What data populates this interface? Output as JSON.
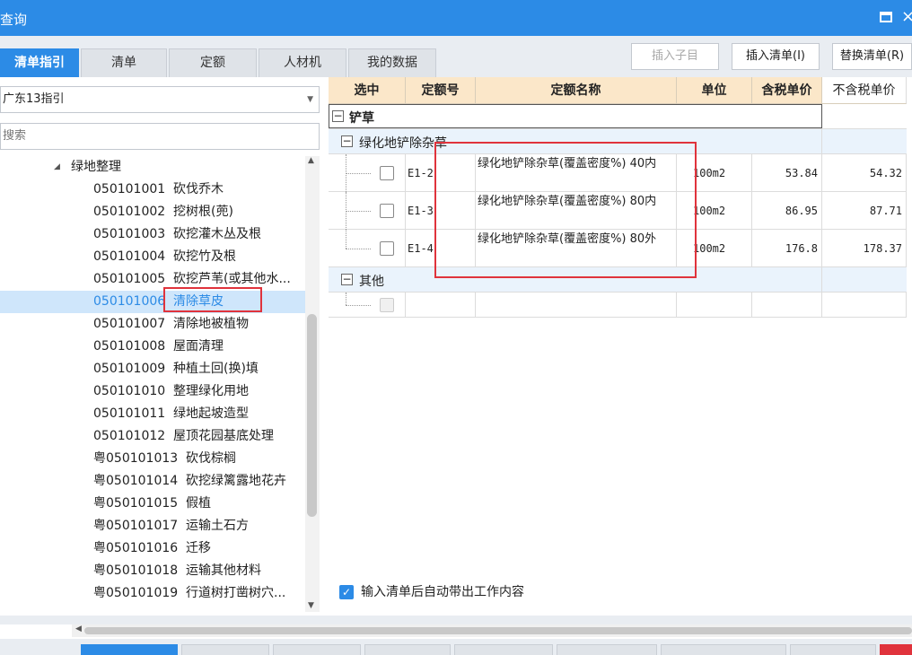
{
  "window": {
    "title": "查询"
  },
  "tabs": [
    {
      "label": "清单指引",
      "active": true
    },
    {
      "label": "清单",
      "active": false
    },
    {
      "label": "定额",
      "active": false
    },
    {
      "label": "人材机",
      "active": false
    },
    {
      "label": "我的数据",
      "active": false
    }
  ],
  "toolbar": {
    "insert_child": "插入子目",
    "insert_list": "插入清单(I)",
    "replace_list": "替换清单(R)"
  },
  "left": {
    "combo_value": "广东13指引",
    "search_placeholder": "搜索",
    "parent": "绿地整理",
    "items": [
      {
        "code": "050101001",
        "name": "砍伐乔木"
      },
      {
        "code": "050101002",
        "name": "挖树根(蔸)"
      },
      {
        "code": "050101003",
        "name": "砍挖灌木丛及根"
      },
      {
        "code": "050101004",
        "name": "砍挖竹及根"
      },
      {
        "code": "050101005",
        "name": "砍挖芦苇(或其他水..."
      },
      {
        "code": "050101006",
        "name": "清除草皮",
        "selected": true
      },
      {
        "code": "050101007",
        "name": "清除地被植物"
      },
      {
        "code": "050101008",
        "name": "屋面清理"
      },
      {
        "code": "050101009",
        "name": "种植土回(换)填"
      },
      {
        "code": "050101010",
        "name": "整理绿化用地"
      },
      {
        "code": "050101011",
        "name": "绿地起坡造型"
      },
      {
        "code": "050101012",
        "name": "屋顶花园基底处理"
      },
      {
        "code": "粤050101013",
        "name": "砍伐棕榈"
      },
      {
        "code": "粤050101014",
        "name": "砍挖绿篱露地花卉"
      },
      {
        "code": "粤050101015",
        "name": "假植"
      },
      {
        "code": "粤050101017",
        "name": "运输土石方"
      },
      {
        "code": "粤050101016",
        "name": "迁移"
      },
      {
        "code": "粤050101018",
        "name": "运输其他材料"
      },
      {
        "code": "粤050101019",
        "name": "行道树打凿树穴..."
      }
    ]
  },
  "table": {
    "headers": {
      "select": "选中",
      "code": "定额号",
      "name": "定额名称",
      "unit": "单位",
      "price_tax": "含税单价",
      "price_notax": "不含税单价"
    },
    "group1": "铲草",
    "subgroup1": "绿化地铲除杂草",
    "rows": [
      {
        "code": "E1-2",
        "name": "绿化地铲除杂草(覆盖密度%) 40内",
        "unit": "100m2",
        "price_tax": "53.84",
        "price_notax": "54.32"
      },
      {
        "code": "E1-3",
        "name": "绿化地铲除杂草(覆盖密度%) 80内",
        "unit": "100m2",
        "price_tax": "86.95",
        "price_notax": "87.71"
      },
      {
        "code": "E1-4",
        "name": "绿化地铲除杂草(覆盖密度%) 80外",
        "unit": "100m2",
        "price_tax": "176.8",
        "price_notax": "178.37"
      }
    ],
    "subgroup2": "其他"
  },
  "auto_content": {
    "label": "输入清单后自动带出工作内容",
    "checked": true
  },
  "colors": {
    "accent": "#2c8be6",
    "header_bg": "#fbe7c9",
    "highlight": "#e0333c"
  }
}
